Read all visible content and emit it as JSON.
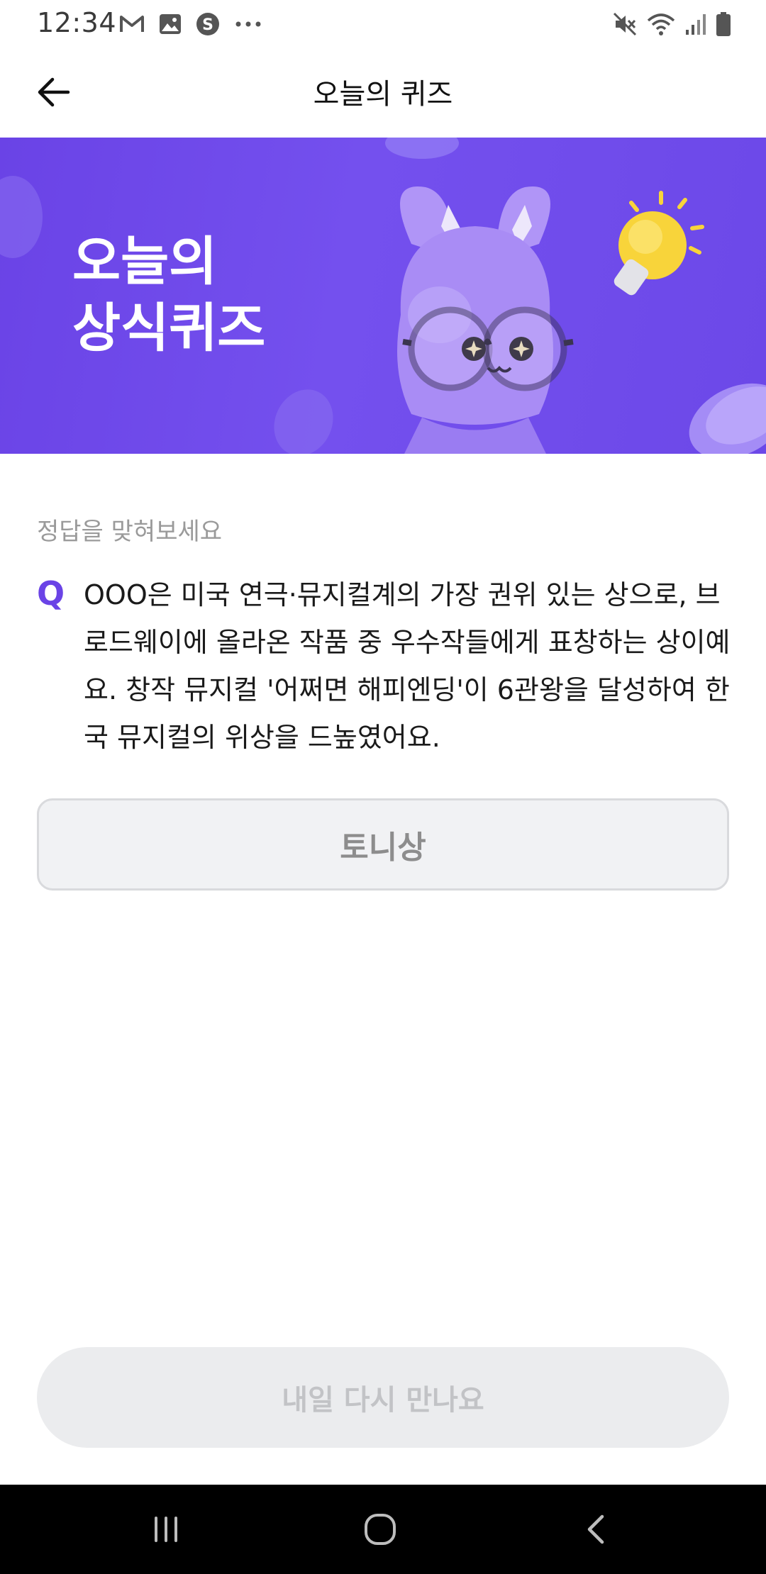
{
  "status_bar": {
    "time": "12:34",
    "left_icons": [
      "gmail-icon",
      "gallery-icon",
      "s-app-icon",
      "more-dots-icon"
    ],
    "right_icons": [
      "mute-icon",
      "wifi-icon",
      "signal-icon",
      "battery-icon"
    ]
  },
  "app_bar": {
    "title": "오늘의 퀴즈",
    "back_icon": "arrow-left-icon"
  },
  "banner": {
    "line1": "오늘의",
    "line2": "상식퀴즈"
  },
  "quiz": {
    "hint": "정답을 맞혀보세요",
    "q_mark": "Q",
    "question": "OOO은 미국 연극·뮤지컬계의 가장 권위 있는 상으로, 브로드웨이에 올라온 작품 중 우수작들에게 표창하는 상이예요. 창작 뮤지컬 '어쩌면 해피엔딩'이 6관왕을 달성하여 한국 뮤지컬의 위상을 드높였어요.",
    "answer": "토니상"
  },
  "bottom_button": {
    "label": "내일 다시 만나요"
  },
  "nav_bar": {
    "icons": [
      "recent-apps-icon",
      "home-icon",
      "back-icon"
    ]
  },
  "colors": {
    "accent": "#6a43e6",
    "banner_bg": "#7450ee",
    "answer_bg": "#f1f2f4",
    "button_bg": "#ebecee"
  }
}
